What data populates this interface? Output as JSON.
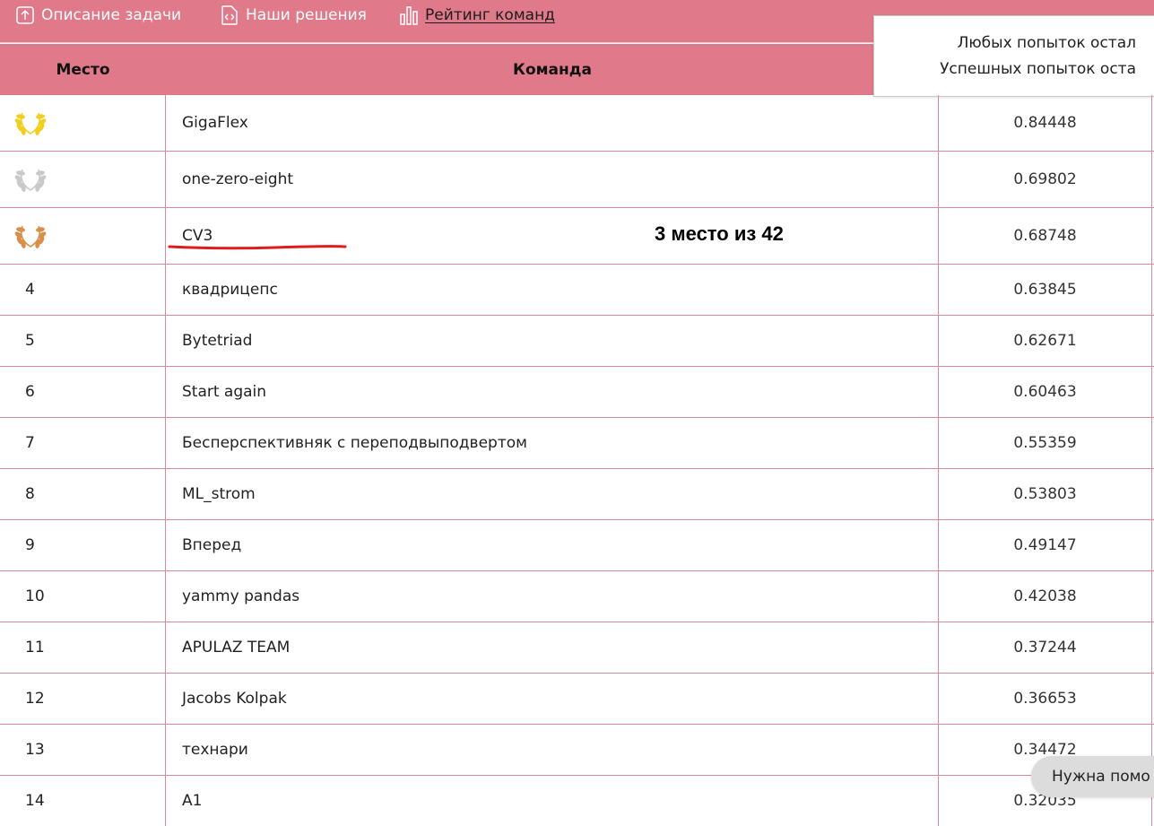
{
  "nav": {
    "items": [
      {
        "label": "Описание задачи",
        "icon": "upload-box-icon"
      },
      {
        "label": "Наши решения",
        "icon": "code-file-icon"
      },
      {
        "label": "Рейтинг команд",
        "icon": "bar-chart-icon"
      }
    ]
  },
  "table": {
    "headers": {
      "place": "Место",
      "team": "Команда"
    },
    "rows": [
      {
        "place": "",
        "medal": "gold",
        "team": "GigaFlex",
        "score": "0.84448"
      },
      {
        "place": "",
        "medal": "silver",
        "team": "one-zero-eight",
        "score": "0.69802"
      },
      {
        "place": "",
        "medal": "bronze",
        "team": "CV3",
        "score": "0.68748"
      },
      {
        "place": "4",
        "medal": "",
        "team": "квадрицепс",
        "score": "0.63845"
      },
      {
        "place": "5",
        "medal": "",
        "team": "Bytetriad",
        "score": "0.62671"
      },
      {
        "place": "6",
        "medal": "",
        "team": "Start again",
        "score": "0.60463"
      },
      {
        "place": "7",
        "medal": "",
        "team": "Бесперспективняк с переподвыподвертом",
        "score": "0.55359"
      },
      {
        "place": "8",
        "medal": "",
        "team": "ML_strom",
        "score": "0.53803"
      },
      {
        "place": "9",
        "medal": "",
        "team": "Вперед",
        "score": "0.49147"
      },
      {
        "place": "10",
        "medal": "",
        "team": "yammy pandas",
        "score": "0.42038"
      },
      {
        "place": "11",
        "medal": "",
        "team": "APULAZ TEAM",
        "score": "0.37244"
      },
      {
        "place": "12",
        "medal": "",
        "team": "Jacobs Kolpak",
        "score": "0.36653"
      },
      {
        "place": "13",
        "medal": "",
        "team": "технари",
        "score": "0.34472"
      },
      {
        "place": "14",
        "medal": "",
        "team": "A1",
        "score": "0.32035"
      }
    ]
  },
  "attempts": {
    "any_left": "Любых попыток остал",
    "successful_left": "Успешных попыток оста"
  },
  "annotation": {
    "text": "3 место из 42"
  },
  "help": {
    "label": "Нужна помо"
  },
  "colors": {
    "header_bg": "#e07a8a",
    "row_border": "#d98a9a",
    "gold": "#f2cf1e",
    "silver": "#c9c9c9",
    "bronze": "#d98e4a",
    "annotation_line": "#e01b1b"
  }
}
